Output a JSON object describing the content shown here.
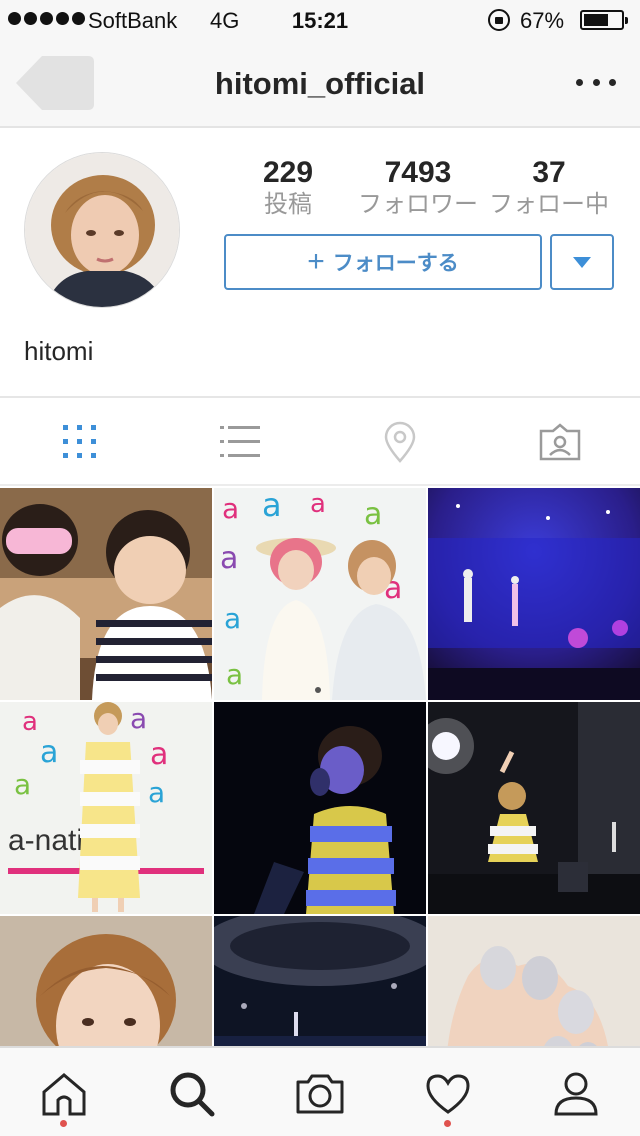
{
  "status_bar": {
    "carrier": "SoftBank",
    "network": "4G",
    "time": "15:21",
    "battery_percent": "67%",
    "battery_level": 0.67,
    "signal_bars": 5
  },
  "nav": {
    "title": "hitomi_official",
    "back_icon": "back-arrow-icon",
    "more_icon": "more-dots-icon"
  },
  "profile": {
    "name": "hitomi",
    "stats": {
      "posts": {
        "value": "229",
        "label": "投稿"
      },
      "followers": {
        "value": "7493",
        "label": "フォロワー"
      },
      "following": {
        "value": "37",
        "label": "フォロー中"
      }
    },
    "follow_label": "フォローする",
    "accent_color": "#4c8cc7"
  },
  "view_tabs": [
    {
      "name": "grid-view",
      "icon": "grid-icon",
      "active": true
    },
    {
      "name": "list-view",
      "icon": "list-icon",
      "active": false
    },
    {
      "name": "location-view",
      "icon": "location-pin-icon",
      "active": false
    },
    {
      "name": "tagged-view",
      "icon": "tagged-person-icon",
      "active": false
    }
  ],
  "photos": [
    {
      "id": "photo-1",
      "overlay_text": ""
    },
    {
      "id": "photo-2",
      "overlay_text": ""
    },
    {
      "id": "photo-3",
      "overlay_text": ""
    },
    {
      "id": "photo-4",
      "overlay_text": "a-nation"
    },
    {
      "id": "photo-5",
      "overlay_text": ""
    },
    {
      "id": "photo-6",
      "overlay_text": ""
    },
    {
      "id": "photo-7",
      "overlay_text": ""
    },
    {
      "id": "photo-8",
      "overlay_text": ""
    },
    {
      "id": "photo-9",
      "overlay_text": ""
    }
  ],
  "tab_bar": [
    {
      "name": "home",
      "icon": "home-icon",
      "has_notification": true
    },
    {
      "name": "search",
      "icon": "search-icon",
      "has_notification": false
    },
    {
      "name": "camera",
      "icon": "camera-icon",
      "has_notification": false
    },
    {
      "name": "activity",
      "icon": "heart-icon",
      "has_notification": true
    },
    {
      "name": "profile",
      "icon": "profile-icon",
      "has_notification": false
    }
  ]
}
